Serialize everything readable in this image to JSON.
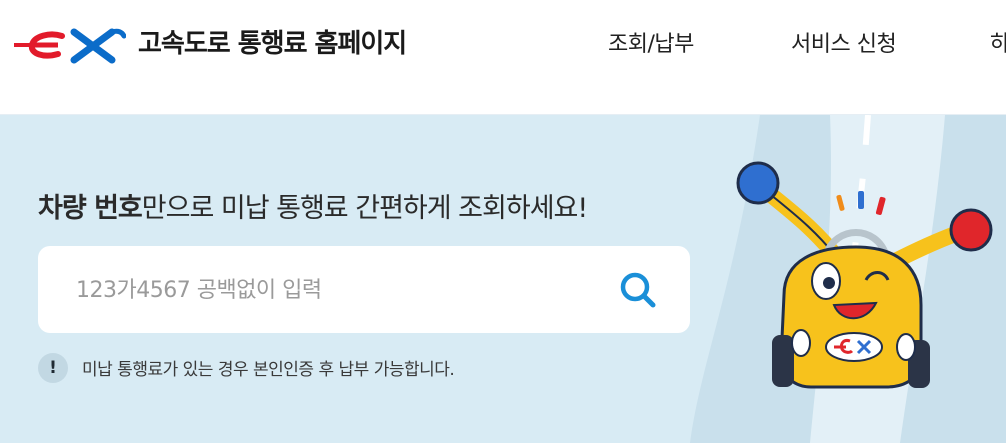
{
  "header": {
    "logo_text": "ex",
    "site_title": "고속도로 통행료 홈페이지",
    "nav": [
      "조회/납부",
      "서비스 신청",
      "하"
    ]
  },
  "hero": {
    "headline_bold": "차량 번호",
    "headline_rest": "만으로 미납 통행료 간편하게 조회하세요!",
    "search": {
      "placeholder": "123가4567 공백없이 입력",
      "value": ""
    },
    "notice_icon": "!",
    "notice": "미납 통행료가 있는 경우 본인인증 후 납부 가능합니다."
  },
  "icons": {
    "search": "search-icon",
    "notice": "exclamation-icon",
    "mascot": "car-mascot-illustration"
  },
  "colors": {
    "brand_red": "#e21b2b",
    "brand_blue": "#0b6cc9",
    "accent_blue": "#1a8fd8",
    "hero_bg": "#d8ebf4"
  }
}
